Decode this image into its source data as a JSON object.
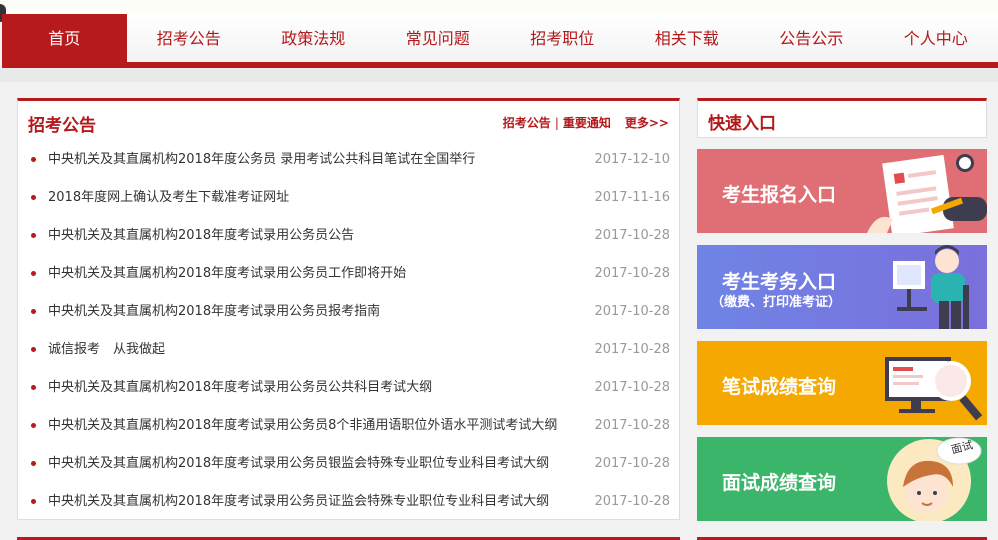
{
  "nav": {
    "items": [
      {
        "label": "首页",
        "active": true
      },
      {
        "label": "招考公告"
      },
      {
        "label": "政策法规"
      },
      {
        "label": "常见问题"
      },
      {
        "label": "招考职位"
      },
      {
        "label": "相关下载"
      },
      {
        "label": "公告公示"
      },
      {
        "label": "个人中心"
      }
    ]
  },
  "news": {
    "title": "招考公告",
    "tab1": "招考公告",
    "tab_sep": "|",
    "tab2": "重要通知",
    "more": "更多>>",
    "items": [
      {
        "title": "中央机关及其直属机构2018年度公务员 录用考试公共科目笔试在全国举行",
        "date": "2017-12-10"
      },
      {
        "title": "2018年度网上确认及考生下载准考证网址",
        "date": "2017-11-16"
      },
      {
        "title": "中央机关及其直属机构2018年度考试录用公务员公告",
        "date": "2017-10-28"
      },
      {
        "title": "中央机关及其直属机构2018年度考试录用公务员工作即将开始",
        "date": "2017-10-28"
      },
      {
        "title": "中央机关及其直属机构2018年度考试录用公务员报考指南",
        "date": "2017-10-28"
      },
      {
        "title": "诚信报考　从我做起",
        "date": "2017-10-28"
      },
      {
        "title": "中央机关及其直属机构2018年度考试录用公务员公共科目考试大纲",
        "date": "2017-10-28"
      },
      {
        "title": "中央机关及其直属机构2018年度考试录用公务员8个非通用语职位外语水平测试考试大纲",
        "date": "2017-10-28"
      },
      {
        "title": "中央机关及其直属机构2018年度考试录用公务员银监会特殊专业职位专业科目考试大纲",
        "date": "2017-10-28"
      },
      {
        "title": "中央机关及其直属机构2018年度考试录用公务员证监会特殊专业职位专业科目考试大纲",
        "date": "2017-10-28"
      }
    ]
  },
  "quick": {
    "title": "快速入口",
    "btn1": "考生报名入口",
    "btn2": "考生考务入口",
    "btn2_sub": "（缴费、打印准考证）",
    "btn3": "笔试成绩查询",
    "btn4": "面试成绩查询",
    "btn4_bubble": "面试"
  },
  "colors": {
    "brand": "#b61a1c",
    "q1": "#df6f74",
    "q2": "#7b7ae0",
    "q3": "#f5a800",
    "q4": "#3ab56a"
  },
  "icons": {
    "btn1": "form-pen-illustration",
    "btn2": "computer-user-illustration",
    "btn3": "screen-magnifier-illustration",
    "btn4": "face-avatar-illustration"
  }
}
